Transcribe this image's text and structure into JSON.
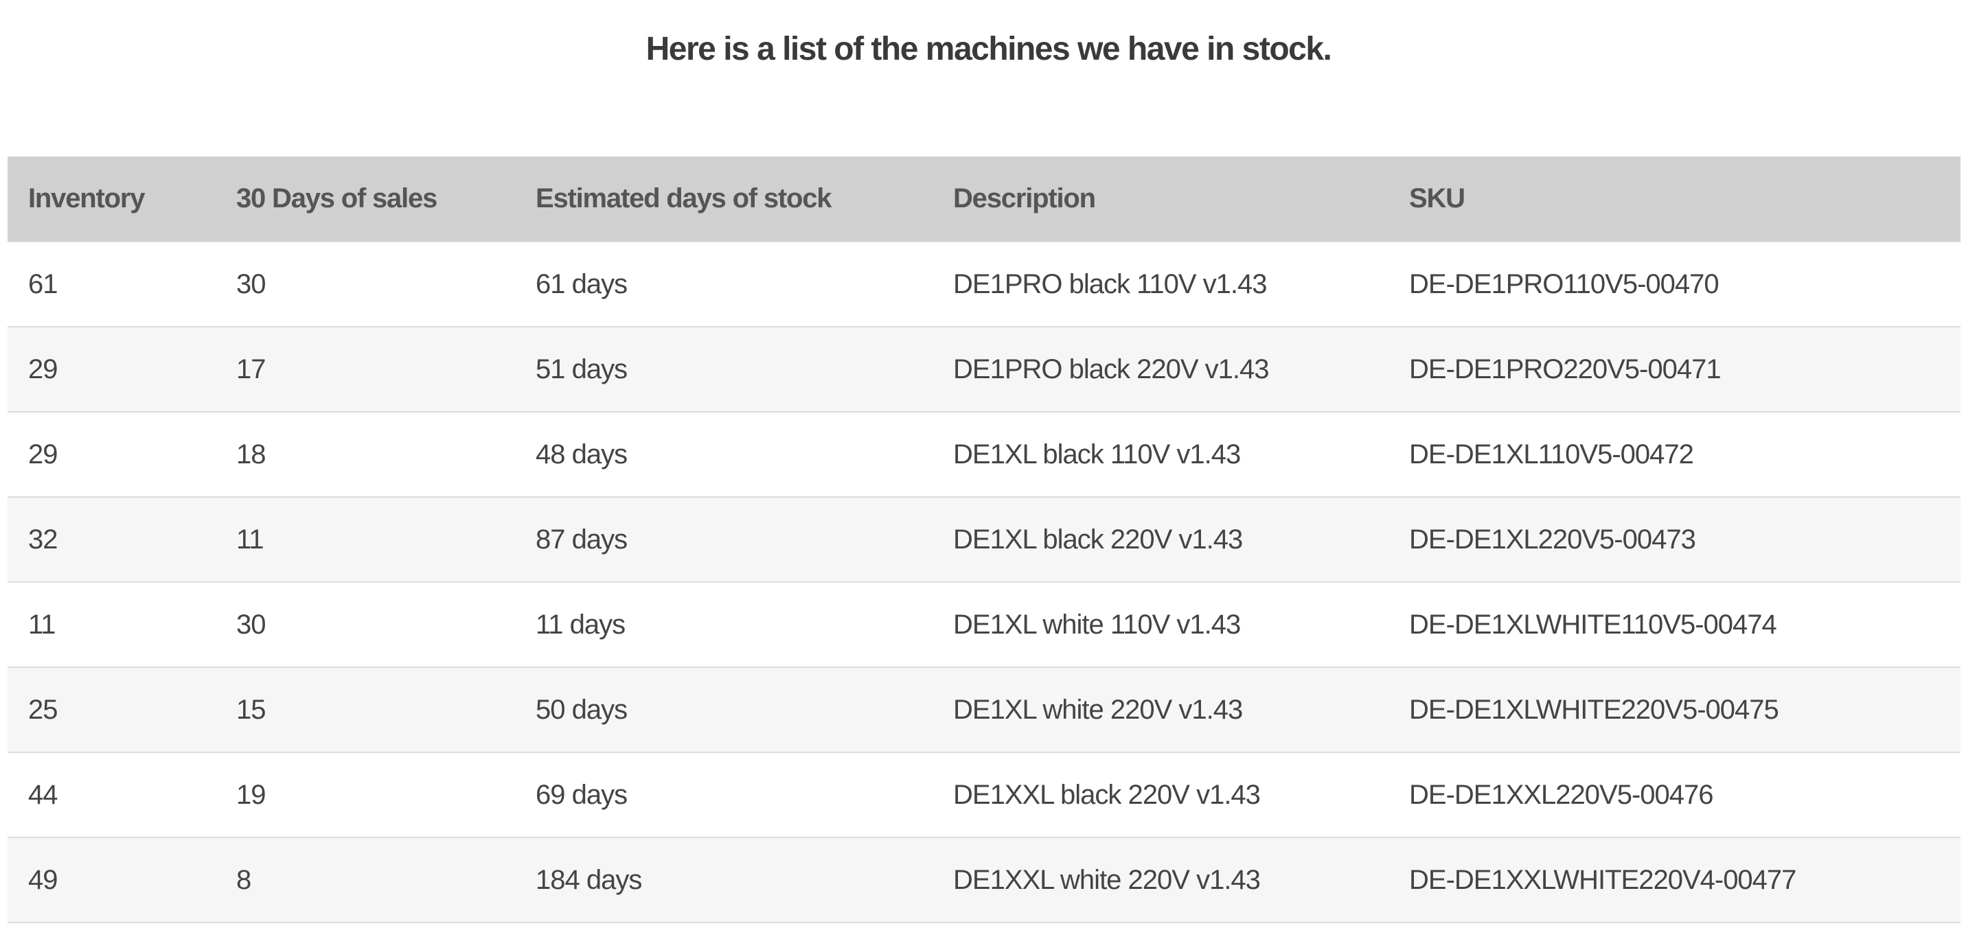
{
  "page": {
    "title": "Here is a list of the machines we have in stock."
  },
  "table": {
    "headers": [
      "Inventory",
      "30 Days of sales",
      "Estimated days of stock",
      "Description",
      "SKU"
    ],
    "rows": [
      [
        "61",
        "30",
        "61 days",
        "DE1PRO black 110V v1.43",
        "DE-DE1PRO110V5-00470"
      ],
      [
        "29",
        "17",
        "51 days",
        "DE1PRO black 220V v1.43",
        "DE-DE1PRO220V5-00471"
      ],
      [
        "29",
        "18",
        "48 days",
        "DE1XL black 110V v1.43",
        "DE-DE1XL110V5-00472"
      ],
      [
        "32",
        "11",
        "87 days",
        "DE1XL black 220V v1.43",
        "DE-DE1XL220V5-00473"
      ],
      [
        "11",
        "30",
        "11 days",
        "DE1XL white 110V v1.43",
        "DE-DE1XLWHITE110V5-00474"
      ],
      [
        "25",
        "15",
        "50 days",
        "DE1XL white 220V v1.43",
        "DE-DE1XLWHITE220V5-00475"
      ],
      [
        "44",
        "19",
        "69 days",
        "DE1XXL black 220V v1.43",
        "DE-DE1XXL220V5-00476"
      ],
      [
        "49",
        "8",
        "184 days",
        "DE1XXL white 220V v1.43",
        "DE-DE1XXLWHITE220V4-00477"
      ]
    ]
  },
  "colors": {
    "header_bg": "#d0d0d0",
    "row_alt_bg": "#f6f6f6",
    "row_border": "#dcdcdc",
    "text": "#444444",
    "title": "#3a3a3a"
  }
}
